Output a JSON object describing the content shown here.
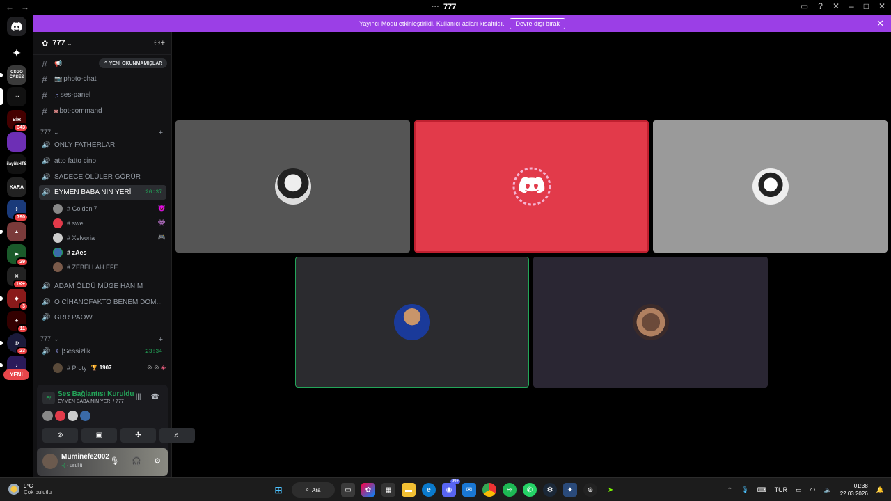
{
  "window": {
    "title": "777"
  },
  "banner": {
    "message": "Yayıncı Modu etkinleştirildi. Kullanıcı adları kısaltıldı.",
    "button": "Devre dışı bırak"
  },
  "server": {
    "name": "777"
  },
  "unread_pill": "YENİ OKUNMAMIŞLAR",
  "text_channels": [
    {
      "name": ""
    },
    {
      "name": "photo-chat"
    },
    {
      "name": "ses-panel"
    },
    {
      "name": "bot-command"
    }
  ],
  "category1": "777",
  "voice_channels": [
    {
      "name": "ONLY FATHERLAR"
    },
    {
      "name": "atto fatto cino"
    },
    {
      "name": "SADECE ÖLÜLER GÖRÜR"
    },
    {
      "name": "EYMEN BABA NIN YERİ",
      "time": "20:37"
    }
  ],
  "voice_users": [
    {
      "name": "# Goldenj7"
    },
    {
      "name": "# swe"
    },
    {
      "name": "# Xelvoria"
    },
    {
      "name": "# zAes"
    },
    {
      "name": "# ZEBELLAH EFE"
    }
  ],
  "voice_channels_2": [
    {
      "name": "ADAM ÖLDÜ MÜGE HANIM"
    },
    {
      "name": "O CİHANOFAKTO BENEM DOM..."
    },
    {
      "name": "GRR PAOW"
    }
  ],
  "category2": "777",
  "voice_channel_3": {
    "name": "|Sessizlik",
    "time": "23:34"
  },
  "voice_user_3": {
    "name": "# Proty",
    "score": "1907"
  },
  "guild_badges": [
    "343",
    "790",
    "29",
    "1K+",
    "3",
    "11",
    "23"
  ],
  "guild_labels": [
    "CSGO CASES",
    "KARA",
    "ilayükHTS"
  ],
  "new_pill": "YENİ",
  "voice_panel": {
    "status": "Ses Bağlantısı Kuruldu",
    "channel": "EYMEN BABA NIN YERİ / 777"
  },
  "user": {
    "name": "Muminefe2002",
    "status": "usullü"
  },
  "taskbar": {
    "search": "Ara",
    "temp": "9°C",
    "condition": "Çok bulutlu",
    "lang": "TUR",
    "time": "01:38",
    "date": "22.03.2026",
    "notification_badge": "99+"
  }
}
